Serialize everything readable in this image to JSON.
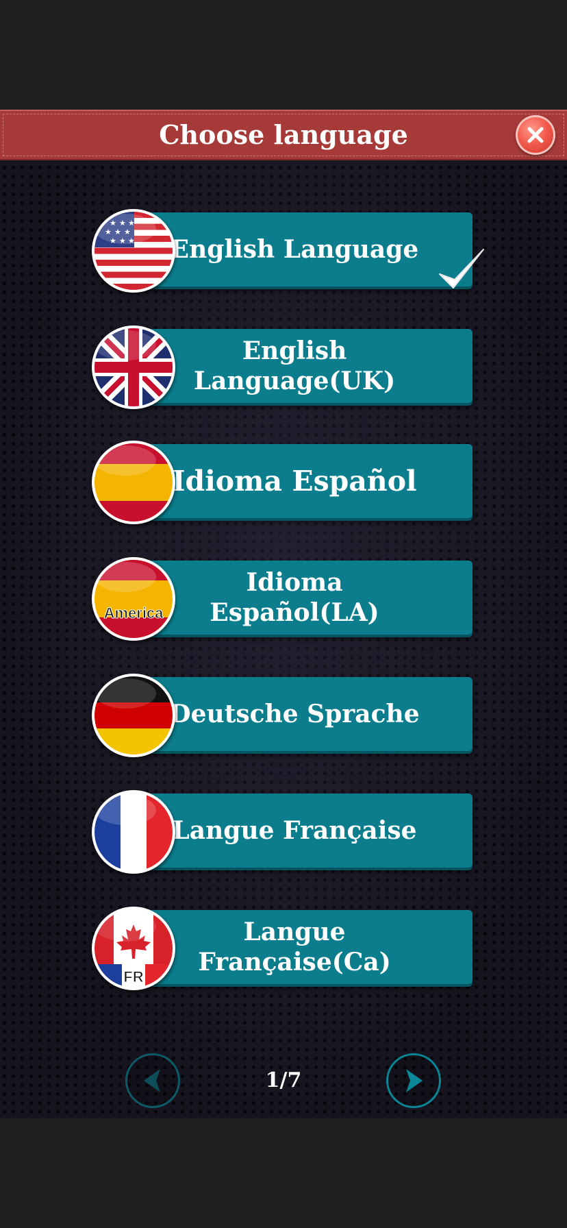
{
  "header": {
    "title": "Choose language"
  },
  "languages": [
    {
      "label": "English Language",
      "flag": "us-flag-icon",
      "selected": true
    },
    {
      "label": "English\nLanguage(UK)",
      "flag": "uk-flag-icon",
      "selected": false
    },
    {
      "label": "Idioma Español",
      "flag": "spain-flag-icon",
      "selected": false
    },
    {
      "label": "Idioma\nEspañol(LA)",
      "flag": "spain-america-flag-icon",
      "badge": "America",
      "selected": false
    },
    {
      "label": "Deutsche Sprache",
      "flag": "germany-flag-icon",
      "selected": false
    },
    {
      "label": "Langue Française",
      "flag": "france-flag-icon",
      "selected": false
    },
    {
      "label": "Langue\nFrançaise(Ca)",
      "flag": "canada-french-flag-icon",
      "badge": "FR",
      "selected": false
    }
  ],
  "pagination": {
    "indicator": "1/7"
  },
  "colors": {
    "header_bg": "#a63a38",
    "button_bg": "#0b7d8c",
    "close_button": "#f2584b",
    "panel_bg": "#16151f"
  }
}
